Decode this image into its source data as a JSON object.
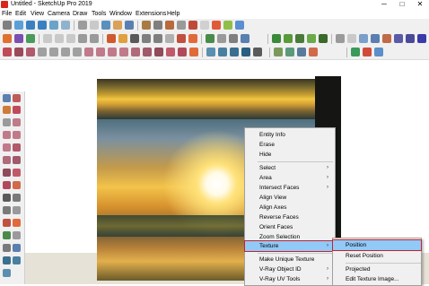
{
  "window": {
    "title": "Untitled - SketchUp Pro 2019",
    "minimize": "─",
    "maximize": "□",
    "close": "✕"
  },
  "menu": [
    "File",
    "Edit",
    "View",
    "Camera",
    "Draw",
    "Tools",
    "Window",
    "Extensions",
    "Help"
  ],
  "colors": {
    "highlight": "#91c9f7",
    "highlight_border": "#c6212f",
    "menu_bg": "#f0f0f0",
    "brand": "#d9261c"
  },
  "context_menu": {
    "items": [
      {
        "label": "Entity Info"
      },
      {
        "label": "Erase"
      },
      {
        "label": "Hide"
      },
      {
        "label": "Select",
        "submenu": true
      },
      {
        "label": "Area",
        "submenu": true
      },
      {
        "label": "Intersect Faces",
        "submenu": true
      },
      {
        "label": "Align View"
      },
      {
        "label": "Align Axes"
      },
      {
        "label": "Reverse Faces"
      },
      {
        "label": "Orient Faces"
      },
      {
        "label": "Zoom Selection"
      },
      {
        "label": "Texture",
        "submenu": true,
        "highlighted": true
      },
      {
        "label": "Make Unique Texture"
      },
      {
        "label": "V-Ray Object ID",
        "submenu": true
      },
      {
        "label": "V-Ray UV Tools",
        "submenu": true
      }
    ],
    "arrow": "›"
  },
  "texture_submenu": {
    "items": [
      {
        "label": "Position",
        "highlighted": true
      },
      {
        "label": "Reset Position"
      },
      {
        "label": "Projected"
      },
      {
        "label": "Edit Texture Image..."
      }
    ]
  }
}
